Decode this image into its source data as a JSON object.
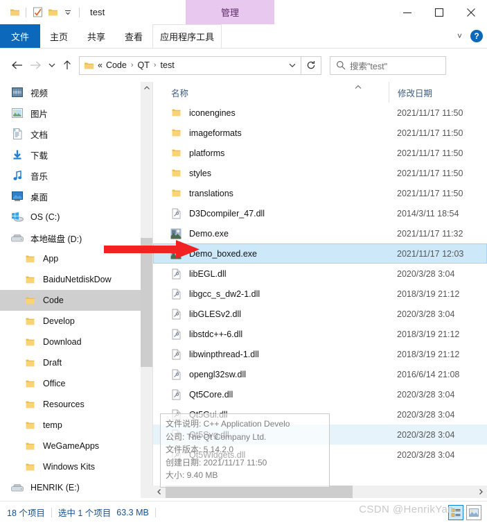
{
  "window": {
    "title": "test",
    "contextual_tab": "管理",
    "quick_access": [
      {
        "name": "folder-icon",
        "label": "文件夹"
      },
      {
        "name": "properties-icon",
        "label": "属性"
      },
      {
        "name": "new-folder-icon",
        "label": "新建文件夹"
      },
      {
        "name": "chevron-down-icon",
        "label": "自定义快速访问工具栏"
      }
    ],
    "controls": {
      "minimize": "—",
      "maximize": "□",
      "close": "✕"
    }
  },
  "ribbon": {
    "tabs": [
      {
        "label": "文件",
        "active": true
      },
      {
        "label": "主页",
        "active": false
      },
      {
        "label": "共享",
        "active": false
      },
      {
        "label": "查看",
        "active": false
      },
      {
        "label": "应用程序工具",
        "active": false,
        "contextual": true
      }
    ],
    "collapse_label": "˅",
    "help_label": "?",
    "accent_color": "#0b68ba",
    "contextual_color": "#e8c8ee"
  },
  "nav": {
    "back": "←",
    "forward": "→",
    "recent": "˅",
    "up": "↑",
    "address": {
      "ellipsis": "«",
      "crumbs": [
        "Code",
        "QT",
        "test"
      ],
      "separator": "›",
      "dropdown": "˅"
    },
    "refresh": "↻",
    "search": {
      "placeholder": "搜索\"test\"",
      "icon": "search-icon"
    }
  },
  "sidebar": {
    "items": [
      {
        "label": "视频",
        "icon": "video-icon",
        "indent": false,
        "selected": false
      },
      {
        "label": "图片",
        "icon": "pictures-icon",
        "indent": false,
        "selected": false
      },
      {
        "label": "文档",
        "icon": "documents-icon",
        "indent": false,
        "selected": false
      },
      {
        "label": "下载",
        "icon": "downloads-icon",
        "indent": false,
        "selected": false
      },
      {
        "label": "音乐",
        "icon": "music-icon",
        "indent": false,
        "selected": false
      },
      {
        "label": "桌面",
        "icon": "desktop-icon",
        "indent": false,
        "selected": false
      },
      {
        "label": "OS (C:)",
        "icon": "windows-drive-icon",
        "indent": false,
        "selected": false
      },
      {
        "label": "本地磁盘 (D:)",
        "icon": "drive-icon",
        "indent": false,
        "selected": false
      },
      {
        "label": "App",
        "icon": "folder-icon",
        "indent": true,
        "selected": false
      },
      {
        "label": "BaiduNetdiskDow",
        "icon": "folder-icon",
        "indent": true,
        "selected": false
      },
      {
        "label": "Code",
        "icon": "folder-icon",
        "indent": true,
        "selected": true
      },
      {
        "label": "Develop",
        "icon": "folder-icon",
        "indent": true,
        "selected": false
      },
      {
        "label": "Download",
        "icon": "folder-icon",
        "indent": true,
        "selected": false
      },
      {
        "label": "Draft",
        "icon": "folder-icon",
        "indent": true,
        "selected": false
      },
      {
        "label": "Office",
        "icon": "folder-icon",
        "indent": true,
        "selected": false
      },
      {
        "label": "Resources",
        "icon": "folder-icon",
        "indent": true,
        "selected": false
      },
      {
        "label": "temp",
        "icon": "folder-icon",
        "indent": true,
        "selected": false
      },
      {
        "label": "WeGameApps",
        "icon": "folder-icon",
        "indent": true,
        "selected": false
      },
      {
        "label": "Windows Kits",
        "icon": "folder-icon",
        "indent": true,
        "selected": false
      },
      {
        "label": "HENRIK (E:)",
        "icon": "drive-icon",
        "indent": false,
        "selected": false
      }
    ],
    "scroll_up": "˄",
    "scroll_down": "˅"
  },
  "filelist": {
    "columns": [
      {
        "label": "名称",
        "key": "name"
      },
      {
        "label": "修改日期",
        "key": "date"
      }
    ],
    "sort_indicator": "˄",
    "rows": [
      {
        "name": "iconengines",
        "date": "2021/11/17 11:50",
        "icon": "folder-icon",
        "state": "normal"
      },
      {
        "name": "imageformats",
        "date": "2021/11/17 11:50",
        "icon": "folder-icon",
        "state": "normal"
      },
      {
        "name": "platforms",
        "date": "2021/11/17 11:50",
        "icon": "folder-icon",
        "state": "normal"
      },
      {
        "name": "styles",
        "date": "2021/11/17 11:50",
        "icon": "folder-icon",
        "state": "normal"
      },
      {
        "name": "translations",
        "date": "2021/11/17 11:50",
        "icon": "folder-icon",
        "state": "normal"
      },
      {
        "name": "D3Dcompiler_47.dll",
        "date": "2014/3/11 18:54",
        "icon": "dll-icon",
        "state": "normal"
      },
      {
        "name": "Demo.exe",
        "date": "2021/11/17 11:32",
        "icon": "exe-icon",
        "state": "normal"
      },
      {
        "name": "Demo_boxed.exe",
        "date": "2021/11/17 12:03",
        "icon": "exe-icon",
        "state": "selected"
      },
      {
        "name": "libEGL.dll",
        "date": "2020/3/28 3:04",
        "icon": "dll-icon",
        "state": "normal"
      },
      {
        "name": "libgcc_s_dw2-1.dll",
        "date": "2018/3/19 21:12",
        "icon": "dll-icon",
        "state": "normal"
      },
      {
        "name": "libGLESv2.dll",
        "date": "2020/3/28 3:04",
        "icon": "dll-icon",
        "state": "normal"
      },
      {
        "name": "libstdc++-6.dll",
        "date": "2018/3/19 21:12",
        "icon": "dll-icon",
        "state": "normal"
      },
      {
        "name": "libwinpthread-1.dll",
        "date": "2018/3/19 21:12",
        "icon": "dll-icon",
        "state": "normal"
      },
      {
        "name": "opengl32sw.dll",
        "date": "2016/6/14 21:08",
        "icon": "dll-icon",
        "state": "normal"
      },
      {
        "name": "Qt5Core.dll",
        "date": "2020/3/28 3:04",
        "icon": "dll-icon",
        "state": "normal"
      },
      {
        "name": "Qt5Gui.dll",
        "date": "2020/3/28 3:04",
        "icon": "dll-icon",
        "state": "normal"
      },
      {
        "name": "Qt5Svg.dll",
        "date": "2020/3/28 3:04",
        "icon": "dll-icon",
        "state": "hover"
      },
      {
        "name": "Qt5Widgets.dll",
        "date": "2020/3/28 3:04",
        "icon": "dll-icon",
        "state": "normal"
      }
    ]
  },
  "tooltip": {
    "lines": [
      "文件说明: C++ Application Develo",
      "公司: The Qt Company Ltd.",
      "文件版本: 5.14.2.0",
      "创建日期: 2021/11/17 11:50",
      "大小: 9.40 MB"
    ]
  },
  "hscroll": {
    "left_arrow": "‹",
    "right_arrow": "›"
  },
  "statusbar": {
    "item_count": "18 个项目",
    "selection": "选中 1 个项目",
    "selection_size": "63.3 MB",
    "view_buttons": [
      {
        "name": "details-view-button",
        "active": true
      },
      {
        "name": "large-icons-view-button",
        "active": false
      }
    ]
  },
  "watermark": {
    "text": "CSDN @HenrikYan"
  },
  "annotation": {
    "arrow_color": "#f22222",
    "points_to": "Demo_boxed.exe"
  }
}
